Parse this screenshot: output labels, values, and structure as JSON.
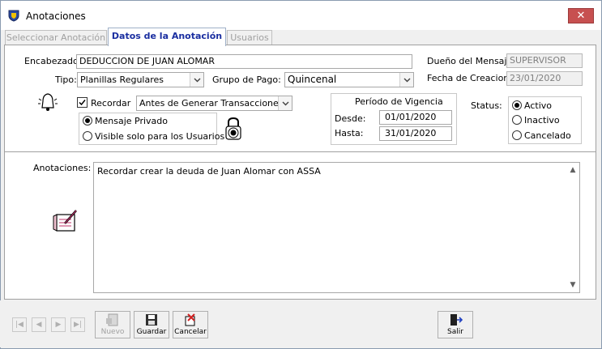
{
  "window": {
    "title": "Anotaciones",
    "close_glyph": "✕"
  },
  "tabs": [
    {
      "label": "Seleccionar Anotación",
      "active": false
    },
    {
      "label": "Datos de la Anotación",
      "active": true
    },
    {
      "label": "Usuarios",
      "active": false
    }
  ],
  "form": {
    "encabezado_label": "Encabezado:",
    "encabezado_value": "DEDUCCION DE JUAN ALOMAR",
    "dueno_label": "Dueño del Mensaje:",
    "dueno_value": "SUPERVISOR",
    "tipo_label": "Tipo:",
    "tipo_value": "Planillas Regulares",
    "grupo_label": "Grupo de Pago:",
    "grupo_value": "Quincenal",
    "fecha_label": "Fecha de Creacion:",
    "fecha_value": "23/01/2020",
    "recordar_label": "Recordar",
    "recordar_checked": true,
    "recordar_option": "Antes de Generar Transacciones",
    "privado_label": "Mensaje Privado",
    "visible_label": "Visible solo para los Usuarios :",
    "periodo_title": "Período de Vigencia",
    "desde_label": "Desde:",
    "desde_value": "01/01/2020",
    "hasta_label": "Hasta:",
    "hasta_value": "31/01/2020",
    "status_label": "Status:",
    "status_options": [
      "Activo",
      "Inactivo",
      "Cancelado"
    ],
    "status_selected": "Activo",
    "anotaciones_label": "Anotaciones:",
    "anotaciones_value": "Recordar crear la deuda de Juan Alomar con ASSA"
  },
  "toolbar": {
    "nuevo_label": "Nuevo",
    "guardar_label": "Guardar",
    "cancelar_label": "Cancelar",
    "salir_label": "Salir"
  },
  "colors": {
    "active_tab_text": "#1a2ea0",
    "close_button": "#c75050"
  }
}
